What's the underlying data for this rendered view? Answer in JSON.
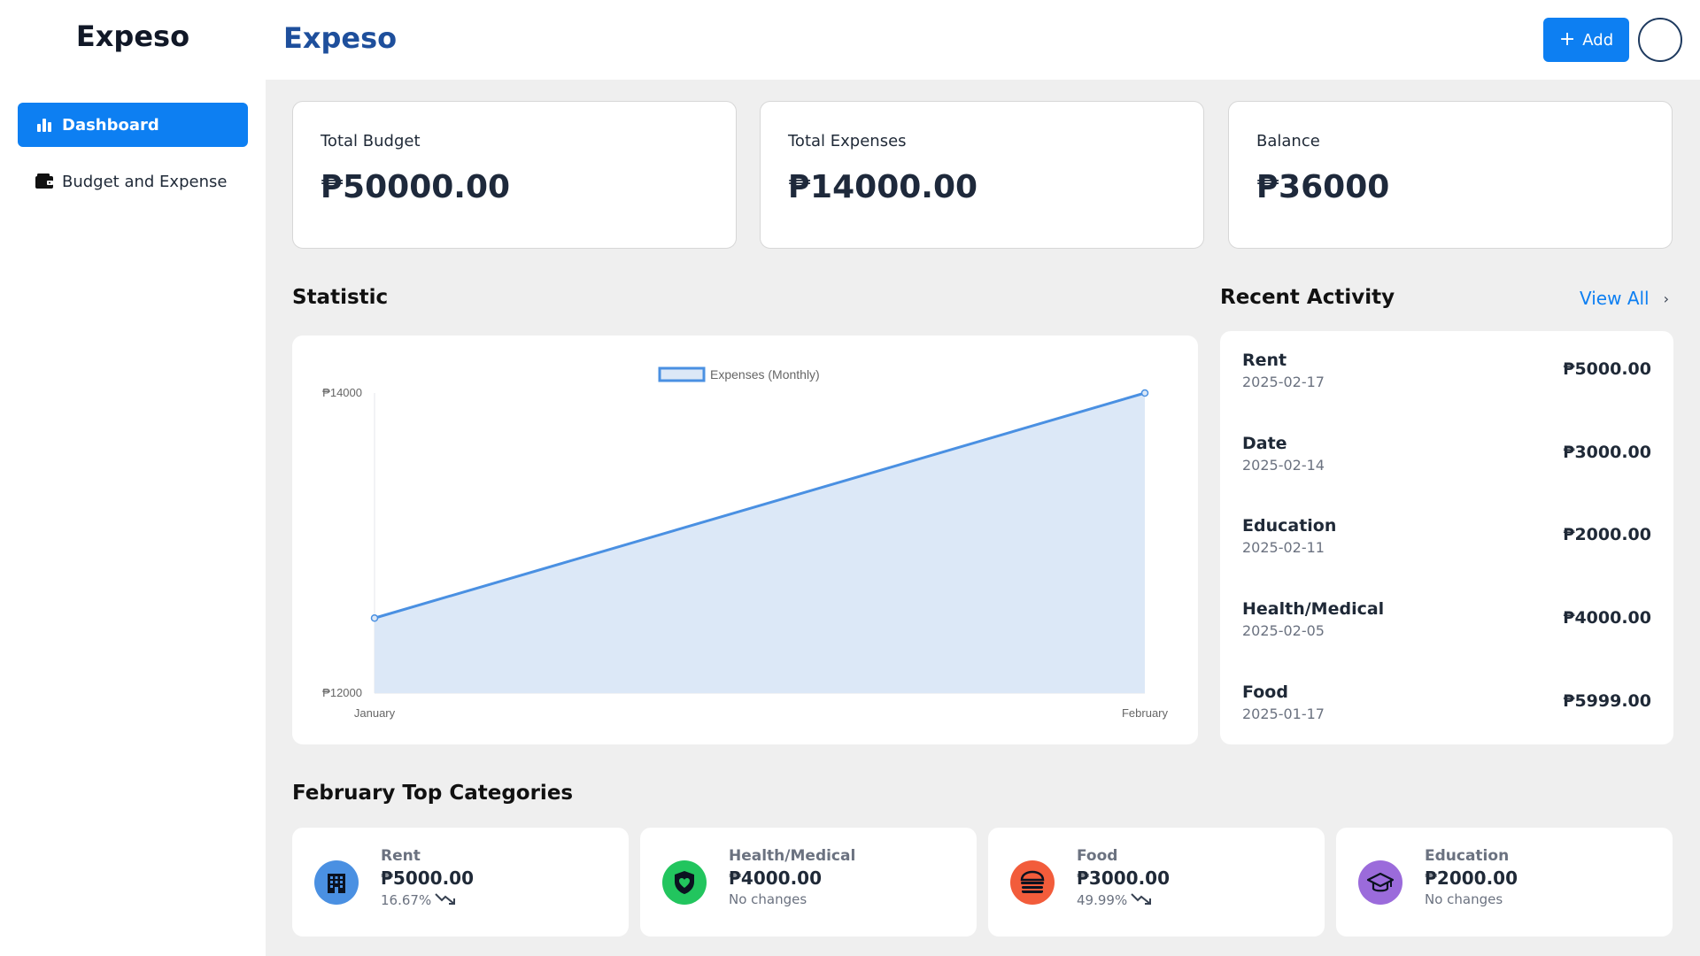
{
  "sidebar": {
    "logo": "Expeso",
    "items": [
      {
        "label": "Dashboard",
        "icon": "bar-chart-icon",
        "active": true
      },
      {
        "label": "Budget and Expense",
        "icon": "wallet-icon",
        "active": false
      }
    ]
  },
  "header": {
    "title": "Expeso",
    "add_label": "Add"
  },
  "stats": [
    {
      "label": "Total Budget",
      "value": "₱50000.00"
    },
    {
      "label": "Total Expenses",
      "value": "₱14000.00"
    },
    {
      "label": "Balance",
      "value": "₱36000"
    }
  ],
  "statistic": {
    "title": "Statistic"
  },
  "chart_data": {
    "type": "area",
    "title": "",
    "categories": [
      "January",
      "February"
    ],
    "series": [
      {
        "name": "Expenses (Monthly)",
        "values": [
          12500,
          14000
        ]
      }
    ],
    "ylim": [
      12000,
      14000
    ],
    "y_ticks": [
      12000,
      14000
    ],
    "y_tick_labels": [
      "₱12000",
      "₱14000"
    ],
    "xlabel": "",
    "ylabel": "",
    "grid": false,
    "legend": "top",
    "colors": {
      "line": "#4a90e2",
      "fill": "#dce8f7"
    }
  },
  "recent": {
    "title": "Recent Activity",
    "view_all": "View All",
    "items": [
      {
        "name": "Rent",
        "date": "2025-02-17",
        "amount": "₱5000.00"
      },
      {
        "name": "Date",
        "date": "2025-02-14",
        "amount": "₱3000.00"
      },
      {
        "name": "Education",
        "date": "2025-02-11",
        "amount": "₱2000.00"
      },
      {
        "name": "Health/Medical",
        "date": "2025-02-05",
        "amount": "₱4000.00"
      },
      {
        "name": "Food",
        "date": "2025-01-17",
        "amount": "₱5999.00"
      }
    ]
  },
  "top_categories": {
    "title": "February Top Categories",
    "items": [
      {
        "name": "Rent",
        "amount": "₱5000.00",
        "change": "16.67%",
        "trend": "down",
        "icon": "building-icon",
        "color": "#4a90e2"
      },
      {
        "name": "Health/Medical",
        "amount": "₱4000.00",
        "change": "No changes",
        "trend": "none",
        "icon": "shield-heart-icon",
        "color": "#22c55e"
      },
      {
        "name": "Food",
        "amount": "₱3000.00",
        "change": "49.99%",
        "trend": "down",
        "icon": "burger-icon",
        "color": "#f25c3b"
      },
      {
        "name": "Education",
        "amount": "₱2000.00",
        "change": "No changes",
        "trend": "none",
        "icon": "graduation-cap-icon",
        "color": "#9b6bdb"
      }
    ]
  }
}
